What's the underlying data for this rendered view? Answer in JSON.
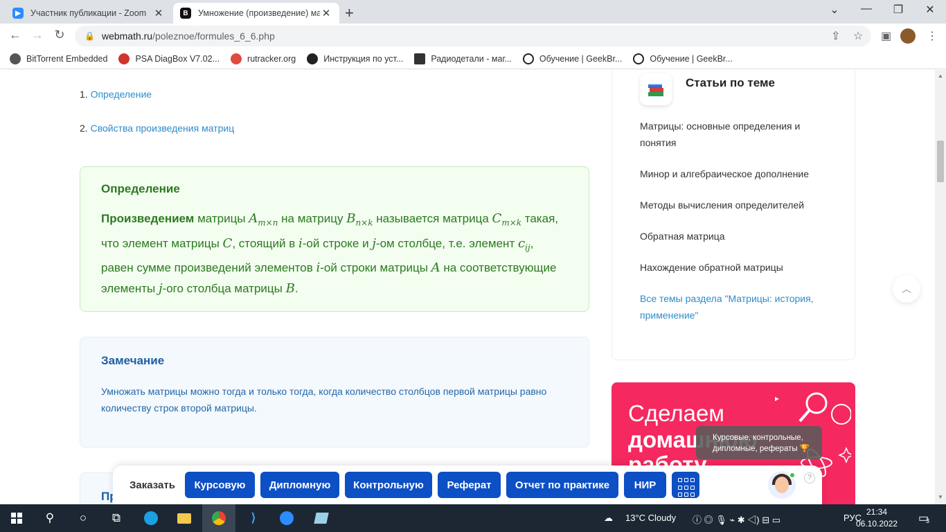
{
  "browser": {
    "tabs": [
      {
        "title": "Участник публикации - Zoom",
        "color": "#2d8cff"
      },
      {
        "title": "Умножение (произведение) ма",
        "color": "#111111"
      }
    ],
    "url_host": "webmath.ru",
    "url_path": "/poleznoe/formules_6_6.php",
    "bookmarks": [
      {
        "label": "BitTorrent Embedded",
        "color": "#555555"
      },
      {
        "label": "PSA DiagBox V7.02...",
        "color": "#d0342c"
      },
      {
        "label": "rutracker.org",
        "color": "#e04a3f"
      },
      {
        "label": "Инструкция по уст...",
        "color": "#222222"
      },
      {
        "label": "Радиодетали - маг...",
        "color": "#333333"
      },
      {
        "label": "Обучение | GeekBr...",
        "color": "#222222"
      },
      {
        "label": "Обучение | GeekBr...",
        "color": "#222222"
      }
    ]
  },
  "toc": [
    {
      "num": "1.",
      "label": "Определение"
    },
    {
      "num": "2.",
      "label": "Свойства произведения матриц"
    }
  ],
  "definition": {
    "title": "Определение",
    "term": "Произведением",
    "t1": " матрицы ",
    "A": "A",
    "A_sub": "m×n",
    "t2": " на матрицу ",
    "B": "B",
    "B_sub": "n×k",
    "t3": " называется матрица ",
    "C": "C",
    "C_sub": "m×k",
    "t4": " такая, что элемент матрицы ",
    "C2": "C",
    "t5": ", стоящий в ",
    "i": "i",
    "t6": "-ой строке и ",
    "j": "j",
    "t7": "-ом столбце, т.е. элемент ",
    "c": "c",
    "c_sub": "ij",
    "t8": ", равен сумме произведений элементов ",
    "i2": "i",
    "t9": "-ой строки матрицы ",
    "A2": "A",
    "t10": " на соответствующие элементы ",
    "j2": "j",
    "t11": "-ого столбца матрицы ",
    "B2": "B",
    "t12": "."
  },
  "note": {
    "title": "Замечание",
    "text": "Умножать матрицы можно тогда и только тогда, когда количество столбцов первой матрицы равно количеству строк второй матрицы."
  },
  "next_section_partial": "Пр",
  "sidebar": {
    "title": "Статьи по теме",
    "links": [
      "Матрицы: основные определения и понятия",
      "Минор и алгебраическое дополнение",
      "Методы вычисления определителей",
      "Обратная матрица",
      "Нахождение обратной матрицы"
    ],
    "all_topics": "Все темы раздела \"Матрицы: история, применение\""
  },
  "promo": {
    "line1": "Сделаем",
    "line2": "домашнюю",
    "line3": "работу",
    "tooltip": "Курсовые, контрольные, дипломные, рефераты 🏆",
    "bg_color": "#f5285f"
  },
  "order_bar": {
    "label": "Заказать",
    "buttons": [
      "Курсовую",
      "Дипломную",
      "Контрольную",
      "Реферат",
      "Отчет по практике",
      "НИР"
    ],
    "help": "?"
  },
  "taskbar": {
    "weather": "13°C  Cloudy",
    "lang": "РУС",
    "time": "21:34",
    "date": "06.10.2022",
    "notifications": "3"
  }
}
